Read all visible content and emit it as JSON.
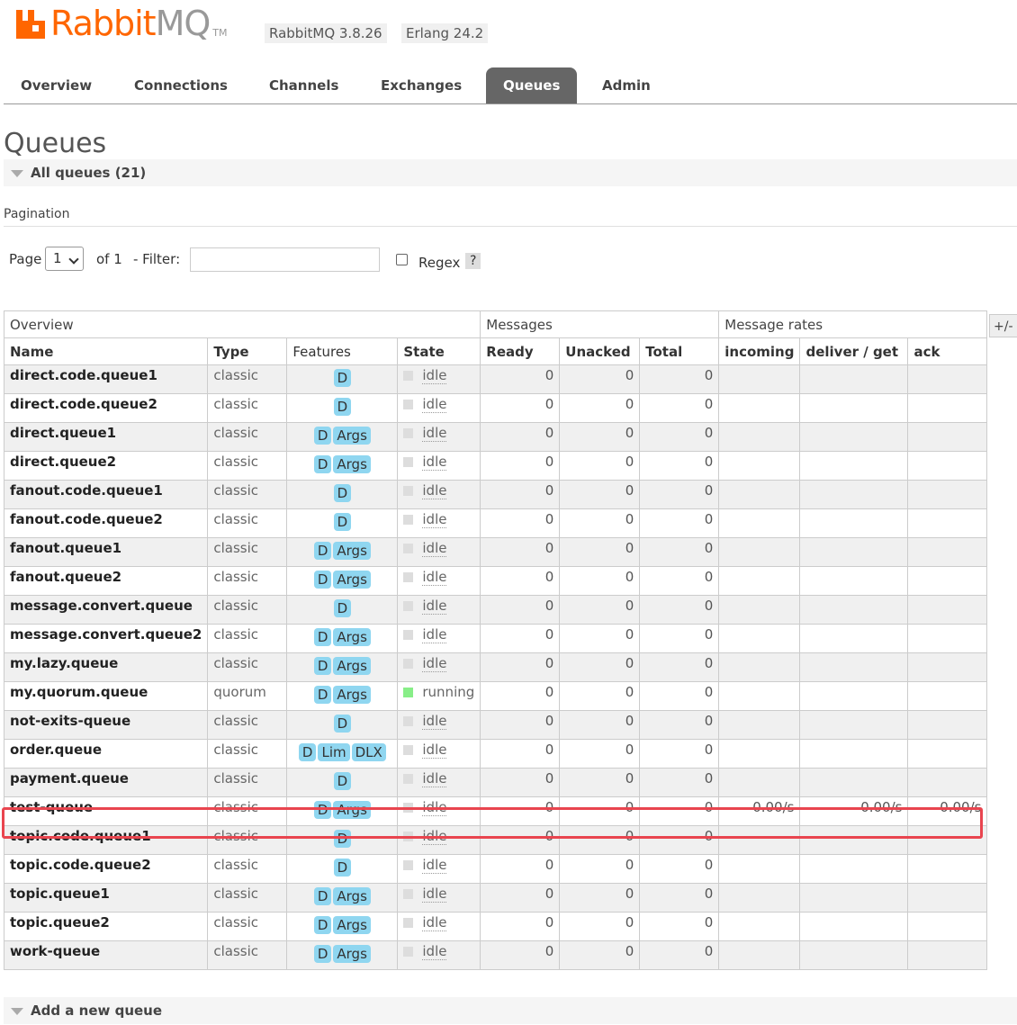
{
  "brand": {
    "name_rabbit": "Rabbit",
    "name_mq": "MQ",
    "tm": "TM",
    "version": "RabbitMQ 3.8.26",
    "erlang": "Erlang 24.2",
    "logo_color": "#ff6600"
  },
  "tabs": [
    {
      "label": "Overview"
    },
    {
      "label": "Connections"
    },
    {
      "label": "Channels"
    },
    {
      "label": "Exchanges"
    },
    {
      "label": "Queues",
      "active": true
    },
    {
      "label": "Admin"
    }
  ],
  "page_title": "Queues",
  "all_queues_label": "All queues (21)",
  "pagination": {
    "label": "Pagination",
    "page_label": "Page",
    "page_value": "1",
    "of_label": "of 1",
    "filter_label": "- Filter:",
    "filter_value": "",
    "regex_label": "Regex",
    "help": "?"
  },
  "plus_minus": "+/-",
  "table": {
    "groups": [
      "Overview",
      "Messages",
      "Message rates"
    ],
    "columns": [
      "Name",
      "Type",
      "Features",
      "State",
      "Ready",
      "Unacked",
      "Total",
      "incoming",
      "deliver / get",
      "ack"
    ],
    "rows": [
      {
        "name": "direct.code.queue1",
        "type": "classic",
        "features": [
          "D"
        ],
        "state": "idle",
        "ready": "0",
        "unacked": "0",
        "total": "0",
        "incoming": "",
        "deliver": "",
        "ack": ""
      },
      {
        "name": "direct.code.queue2",
        "type": "classic",
        "features": [
          "D"
        ],
        "state": "idle",
        "ready": "0",
        "unacked": "0",
        "total": "0",
        "incoming": "",
        "deliver": "",
        "ack": ""
      },
      {
        "name": "direct.queue1",
        "type": "classic",
        "features": [
          "D",
          "Args"
        ],
        "state": "idle",
        "ready": "0",
        "unacked": "0",
        "total": "0",
        "incoming": "",
        "deliver": "",
        "ack": ""
      },
      {
        "name": "direct.queue2",
        "type": "classic",
        "features": [
          "D",
          "Args"
        ],
        "state": "idle",
        "ready": "0",
        "unacked": "0",
        "total": "0",
        "incoming": "",
        "deliver": "",
        "ack": ""
      },
      {
        "name": "fanout.code.queue1",
        "type": "classic",
        "features": [
          "D"
        ],
        "state": "idle",
        "ready": "0",
        "unacked": "0",
        "total": "0",
        "incoming": "",
        "deliver": "",
        "ack": ""
      },
      {
        "name": "fanout.code.queue2",
        "type": "classic",
        "features": [
          "D"
        ],
        "state": "idle",
        "ready": "0",
        "unacked": "0",
        "total": "0",
        "incoming": "",
        "deliver": "",
        "ack": ""
      },
      {
        "name": "fanout.queue1",
        "type": "classic",
        "features": [
          "D",
          "Args"
        ],
        "state": "idle",
        "ready": "0",
        "unacked": "0",
        "total": "0",
        "incoming": "",
        "deliver": "",
        "ack": ""
      },
      {
        "name": "fanout.queue2",
        "type": "classic",
        "features": [
          "D",
          "Args"
        ],
        "state": "idle",
        "ready": "0",
        "unacked": "0",
        "total": "0",
        "incoming": "",
        "deliver": "",
        "ack": ""
      },
      {
        "name": "message.convert.queue",
        "type": "classic",
        "features": [
          "D"
        ],
        "state": "idle",
        "ready": "0",
        "unacked": "0",
        "total": "0",
        "incoming": "",
        "deliver": "",
        "ack": ""
      },
      {
        "name": "message.convert.queue2",
        "type": "classic",
        "features": [
          "D",
          "Args"
        ],
        "state": "idle",
        "ready": "0",
        "unacked": "0",
        "total": "0",
        "incoming": "",
        "deliver": "",
        "ack": ""
      },
      {
        "name": "my.lazy.queue",
        "type": "classic",
        "features": [
          "D",
          "Args"
        ],
        "state": "idle",
        "ready": "0",
        "unacked": "0",
        "total": "0",
        "incoming": "",
        "deliver": "",
        "ack": ""
      },
      {
        "name": "my.quorum.queue",
        "type": "quorum",
        "features": [
          "D",
          "Args"
        ],
        "state": "running",
        "ready": "0",
        "unacked": "0",
        "total": "0",
        "incoming": "",
        "deliver": "",
        "ack": ""
      },
      {
        "name": "not-exits-queue",
        "type": "classic",
        "features": [
          "D"
        ],
        "state": "idle",
        "ready": "0",
        "unacked": "0",
        "total": "0",
        "incoming": "",
        "deliver": "",
        "ack": ""
      },
      {
        "name": "order.queue",
        "type": "classic",
        "features": [
          "D",
          "Lim",
          "DLX"
        ],
        "state": "idle",
        "ready": "0",
        "unacked": "0",
        "total": "0",
        "incoming": "",
        "deliver": "",
        "ack": ""
      },
      {
        "name": "payment.queue",
        "type": "classic",
        "features": [
          "D"
        ],
        "state": "idle",
        "ready": "0",
        "unacked": "0",
        "total": "0",
        "incoming": "",
        "deliver": "",
        "ack": ""
      },
      {
        "name": "test-queue",
        "type": "classic",
        "features": [
          "D",
          "Args"
        ],
        "state": "idle",
        "ready": "0",
        "unacked": "0",
        "total": "0",
        "incoming": "0.00/s",
        "deliver": "0.00/s",
        "ack": "0.00/s"
      },
      {
        "name": "topic.code.queue1",
        "type": "classic",
        "features": [
          "D"
        ],
        "state": "idle",
        "ready": "0",
        "unacked": "0",
        "total": "0",
        "incoming": "",
        "deliver": "",
        "ack": ""
      },
      {
        "name": "topic.code.queue2",
        "type": "classic",
        "features": [
          "D"
        ],
        "state": "idle",
        "ready": "0",
        "unacked": "0",
        "total": "0",
        "incoming": "",
        "deliver": "",
        "ack": ""
      },
      {
        "name": "topic.queue1",
        "type": "classic",
        "features": [
          "D",
          "Args"
        ],
        "state": "idle",
        "ready": "0",
        "unacked": "0",
        "total": "0",
        "incoming": "",
        "deliver": "",
        "ack": ""
      },
      {
        "name": "topic.queue2",
        "type": "classic",
        "features": [
          "D",
          "Args"
        ],
        "state": "idle",
        "ready": "0",
        "unacked": "0",
        "total": "0",
        "incoming": "",
        "deliver": "",
        "ack": ""
      },
      {
        "name": "work-queue",
        "type": "classic",
        "features": [
          "D",
          "Args"
        ],
        "state": "idle",
        "ready": "0",
        "unacked": "0",
        "total": "0",
        "incoming": "",
        "deliver": "",
        "ack": ""
      }
    ]
  },
  "add_queue_label": "Add a new queue",
  "colors": {
    "highlight": "#e9454f",
    "badge": "#8fd6f0",
    "running": "#88ee88",
    "active_tab": "#666666"
  }
}
